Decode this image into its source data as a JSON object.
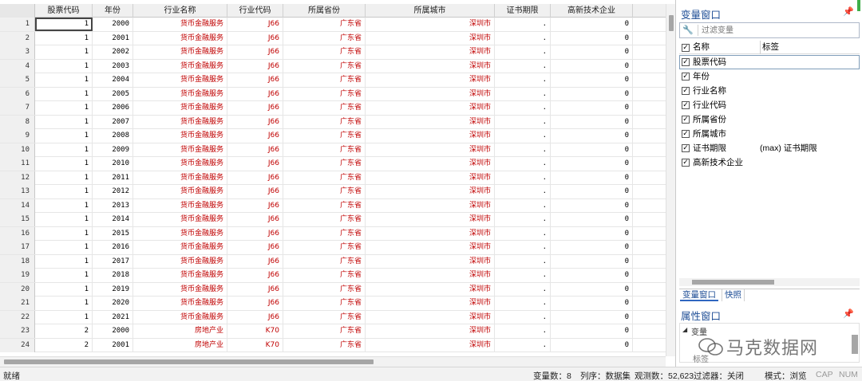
{
  "grid": {
    "columns": [
      "股票代码",
      "年份",
      "行业名称",
      "行业代码",
      "所属省份",
      "所属城市",
      "证书期限",
      "高新技术企业"
    ],
    "rows": [
      [
        "1",
        "1",
        "2000",
        "货币金融服务",
        "J66",
        "广东省",
        "深圳市",
        ".",
        "0"
      ],
      [
        "2",
        "1",
        "2001",
        "货币金融服务",
        "J66",
        "广东省",
        "深圳市",
        ".",
        "0"
      ],
      [
        "3",
        "1",
        "2002",
        "货币金融服务",
        "J66",
        "广东省",
        "深圳市",
        ".",
        "0"
      ],
      [
        "4",
        "1",
        "2003",
        "货币金融服务",
        "J66",
        "广东省",
        "深圳市",
        ".",
        "0"
      ],
      [
        "5",
        "1",
        "2004",
        "货币金融服务",
        "J66",
        "广东省",
        "深圳市",
        ".",
        "0"
      ],
      [
        "6",
        "1",
        "2005",
        "货币金融服务",
        "J66",
        "广东省",
        "深圳市",
        ".",
        "0"
      ],
      [
        "7",
        "1",
        "2006",
        "货币金融服务",
        "J66",
        "广东省",
        "深圳市",
        ".",
        "0"
      ],
      [
        "8",
        "1",
        "2007",
        "货币金融服务",
        "J66",
        "广东省",
        "深圳市",
        ".",
        "0"
      ],
      [
        "9",
        "1",
        "2008",
        "货币金融服务",
        "J66",
        "广东省",
        "深圳市",
        ".",
        "0"
      ],
      [
        "10",
        "1",
        "2009",
        "货币金融服务",
        "J66",
        "广东省",
        "深圳市",
        ".",
        "0"
      ],
      [
        "11",
        "1",
        "2010",
        "货币金融服务",
        "J66",
        "广东省",
        "深圳市",
        ".",
        "0"
      ],
      [
        "12",
        "1",
        "2011",
        "货币金融服务",
        "J66",
        "广东省",
        "深圳市",
        ".",
        "0"
      ],
      [
        "13",
        "1",
        "2012",
        "货币金融服务",
        "J66",
        "广东省",
        "深圳市",
        ".",
        "0"
      ],
      [
        "14",
        "1",
        "2013",
        "货币金融服务",
        "J66",
        "广东省",
        "深圳市",
        ".",
        "0"
      ],
      [
        "15",
        "1",
        "2014",
        "货币金融服务",
        "J66",
        "广东省",
        "深圳市",
        ".",
        "0"
      ],
      [
        "16",
        "1",
        "2015",
        "货币金融服务",
        "J66",
        "广东省",
        "深圳市",
        ".",
        "0"
      ],
      [
        "17",
        "1",
        "2016",
        "货币金融服务",
        "J66",
        "广东省",
        "深圳市",
        ".",
        "0"
      ],
      [
        "18",
        "1",
        "2017",
        "货币金融服务",
        "J66",
        "广东省",
        "深圳市",
        ".",
        "0"
      ],
      [
        "19",
        "1",
        "2018",
        "货币金融服务",
        "J66",
        "广东省",
        "深圳市",
        ".",
        "0"
      ],
      [
        "20",
        "1",
        "2019",
        "货币金融服务",
        "J66",
        "广东省",
        "深圳市",
        ".",
        "0"
      ],
      [
        "21",
        "1",
        "2020",
        "货币金融服务",
        "J66",
        "广东省",
        "深圳市",
        ".",
        "0"
      ],
      [
        "22",
        "1",
        "2021",
        "货币金融服务",
        "J66",
        "广东省",
        "深圳市",
        ".",
        "0"
      ],
      [
        "23",
        "2",
        "2000",
        "房地产业",
        "K70",
        "广东省",
        "深圳市",
        ".",
        "0"
      ],
      [
        "24",
        "2",
        "2001",
        "房地产业",
        "K70",
        "广东省",
        "深圳市",
        ".",
        "0"
      ]
    ]
  },
  "variables_window": {
    "title": "变量窗口",
    "filter_placeholder": "过滤变量",
    "header_name": "名称",
    "header_label": "标签",
    "items": [
      {
        "name": "股票代码",
        "label": ""
      },
      {
        "name": "年份",
        "label": ""
      },
      {
        "name": "行业名称",
        "label": ""
      },
      {
        "name": "行业代码",
        "label": ""
      },
      {
        "name": "所属省份",
        "label": ""
      },
      {
        "name": "所属城市",
        "label": ""
      },
      {
        "name": "证书期限",
        "label": "(max) 证书期限"
      },
      {
        "name": "高新技术企业",
        "label": ""
      }
    ],
    "tabs": [
      "变量窗口",
      "快照"
    ],
    "pin_icon": "pin-icon"
  },
  "properties_window": {
    "title": "属性窗口",
    "section": "变量",
    "label_field": "标签"
  },
  "watermark": "马克数据网",
  "status_bar": {
    "ready": "就绪",
    "var_count": "变量数：8",
    "sort": "列序：数据集",
    "obs_count": "观测数：52,623",
    "filter": "过滤器：关闭",
    "mode": "模式：浏览",
    "cap": "CAP",
    "num": "NUM"
  },
  "colors": {
    "string_value": "#c00000",
    "panel_title": "#1f4e96",
    "accent_green": "#3fae49"
  }
}
